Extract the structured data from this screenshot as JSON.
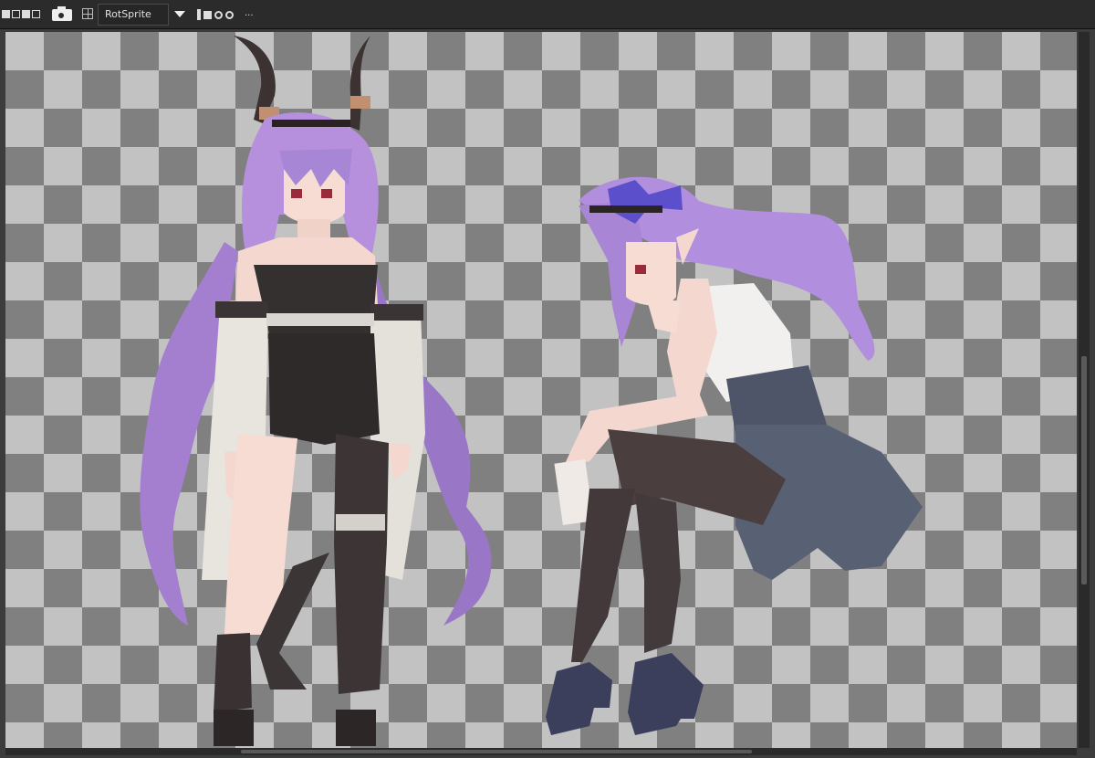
{
  "toolbar": {
    "selection_mode_icons": [
      "replace-selection-icon",
      "add-selection-icon",
      "subtract-selection-icon",
      "intersect-selection-icon"
    ],
    "camera_icon": "camera-icon",
    "grid_icon": "pixel-grid-icon",
    "rotation_algorithm": "RotSprite",
    "dropdown_icon": "chevron-down-icon",
    "tool_icons": [
      "flip-icon",
      "align-icon",
      "pivot-icon",
      "target-icon"
    ],
    "more_label": "..."
  },
  "canvas": {
    "background": "transparent-checkerboard",
    "sprites": [
      "horned-girl-sprite",
      "seated-girl-sprite"
    ]
  },
  "colors": {
    "hair": "#b08ad8",
    "hair_shadow": "#7e5aa6",
    "jacket": "#e6e2dc",
    "outfit_dark": "#36302f",
    "skin": "#f4d8cf",
    "stockings": "#4a3f40",
    "skirt": "#4e5466",
    "bow": "#5a4fc9"
  }
}
